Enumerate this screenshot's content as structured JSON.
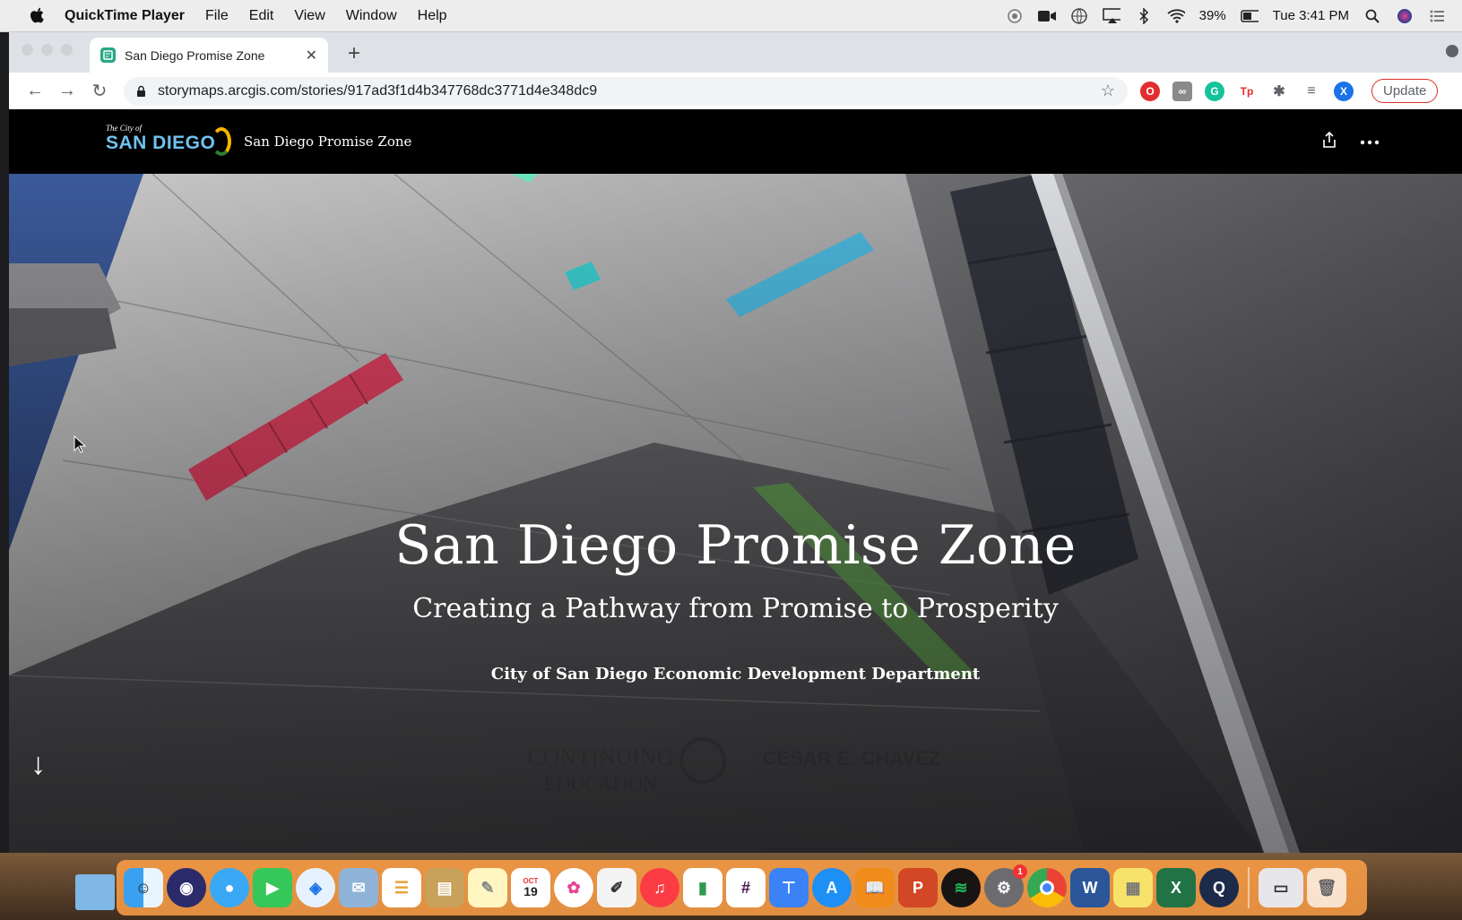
{
  "menubar": {
    "app_name": "QuickTime Player",
    "items": [
      "File",
      "Edit",
      "View",
      "Window",
      "Help"
    ],
    "battery": "39%",
    "clock": "Tue 3:41 PM"
  },
  "browser": {
    "tab_title": "San Diego Promise Zone",
    "url": "storymaps.arcgis.com/stories/917ad3f1d4b347768dc3771d4e348dc9",
    "update_label": "Update",
    "profile_initial": "X"
  },
  "story": {
    "logo_small": "The City of",
    "logo_big": "SAN DIEGO",
    "header_title": "San Diego Promise Zone",
    "title": "San Diego Promise Zone",
    "subtitle": "Creating a Pathway from Promise to Prosperity",
    "byline": "City of San Diego Economic Development Department"
  },
  "dock": {
    "calendar_day": "19",
    "calendar_month": "OCT",
    "badge_count": "1"
  },
  "colors": {
    "accent_blue": "#1a73e8",
    "logo_blue": "#6fc3f0",
    "update_red": "#d93025",
    "dock_orange": "#ffa046"
  }
}
